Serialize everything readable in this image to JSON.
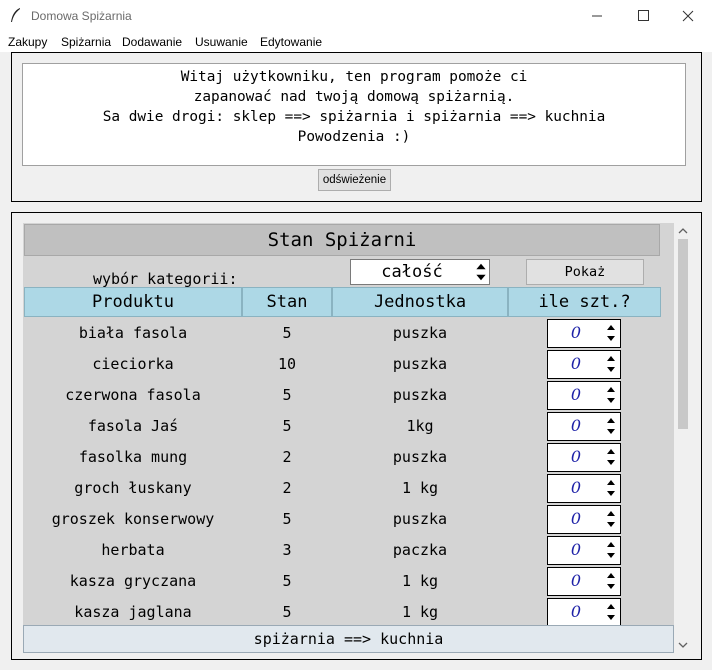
{
  "window": {
    "title": "Domowa Spiżarnia"
  },
  "menu": [
    "Zakupy",
    "Spiżarnia",
    "Dodawanie",
    "Usuwanie",
    "Edytowanie"
  ],
  "welcome": {
    "lines": [
      "Witaj użytkowniku, ten program pomoże ci",
      "zapanować nad twoją domową spiżarnią.",
      "Sa dwie drogi: sklep ==> spiżarnia i spiżarnia ==> kuchnia",
      "Powodzenia :)"
    ]
  },
  "refresh_label": "odświeżenie",
  "pantry": {
    "title": "Stan Spiżarni",
    "category_label": "wybór kategorii:",
    "category_value": "całość",
    "show_label": "Pokaż",
    "columns": [
      "Produktu",
      "Stan",
      "Jednostka",
      "ile szt.?"
    ],
    "rows": [
      {
        "name": "biała fasola",
        "stock": "5",
        "unit": "puszka",
        "qty": "0"
      },
      {
        "name": "cieciorka",
        "stock": "10",
        "unit": "puszka",
        "qty": "0"
      },
      {
        "name": "czerwona fasola",
        "stock": "5",
        "unit": "puszka",
        "qty": "0"
      },
      {
        "name": "fasola Jaś",
        "stock": "5",
        "unit": "1kg",
        "qty": "0"
      },
      {
        "name": "fasolka mung",
        "stock": "2",
        "unit": "puszka",
        "qty": "0"
      },
      {
        "name": "groch łuskany",
        "stock": "2",
        "unit": "1 kg",
        "qty": "0"
      },
      {
        "name": "groszek konserwowy",
        "stock": "5",
        "unit": "puszka",
        "qty": "0"
      },
      {
        "name": "herbata",
        "stock": "3",
        "unit": "paczka",
        "qty": "0"
      },
      {
        "name": "kasza gryczana",
        "stock": "5",
        "unit": "1 kg",
        "qty": "0"
      },
      {
        "name": "kasza jaglana",
        "stock": "5",
        "unit": "1 kg",
        "qty": "0"
      }
    ],
    "bottom_button": "spiżarnia ==> kuchnia"
  },
  "colors": {
    "header_bg": "#add8e6",
    "canvas_bg": "#d4d4d4",
    "qty_text": "#1e22a8"
  }
}
